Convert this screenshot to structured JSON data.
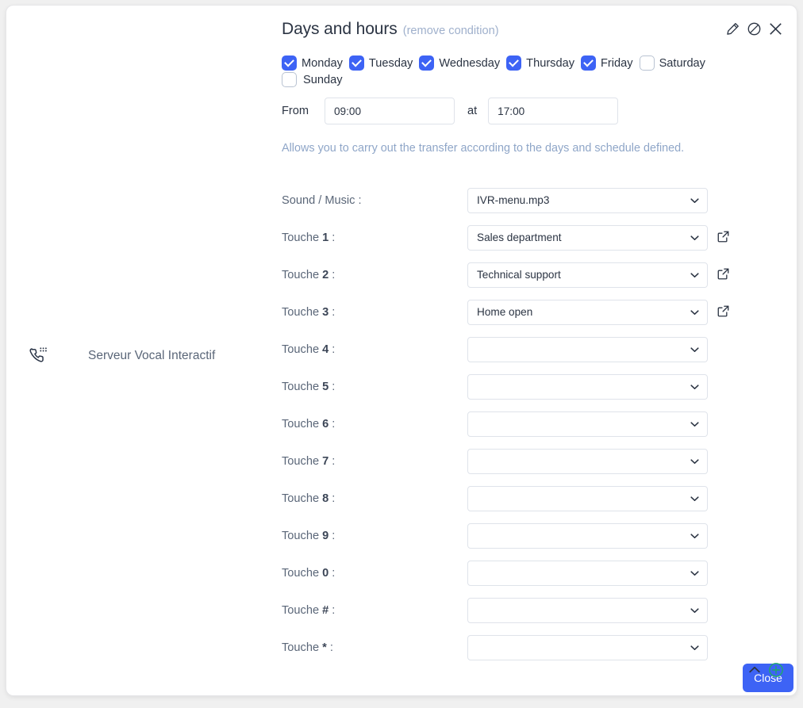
{
  "node": {
    "icon": "ivr-phone-keypad-icon",
    "label": "Serveur Vocal Interactif"
  },
  "panel": {
    "title": "Days and hours",
    "subtitle_open": "(",
    "subtitle_link": "remove condition",
    "subtitle_close": ")",
    "actions": [
      {
        "name": "edit-icon",
        "title": "Edit"
      },
      {
        "name": "disable-icon",
        "title": "Disable"
      },
      {
        "name": "close-icon",
        "title": "Close"
      }
    ],
    "days": [
      {
        "label": "Monday",
        "checked": true
      },
      {
        "label": "Tuesday",
        "checked": true
      },
      {
        "label": "Wednesday",
        "checked": true
      },
      {
        "label": "Thursday",
        "checked": true
      },
      {
        "label": "Friday",
        "checked": true
      },
      {
        "label": "Saturday",
        "checked": false
      },
      {
        "label": "Sunday",
        "checked": false
      }
    ],
    "time": {
      "from_label": "From",
      "from_value": "09:00",
      "at_label": "at",
      "at_value": "17:00"
    },
    "hint": "Allows you to carry out the transfer according to the days and schedule defined."
  },
  "form": {
    "rows": [
      {
        "label_prefix": "Sound / Music",
        "key": "",
        "label_suffix": " :",
        "value": "IVR-menu.mp3",
        "external": false
      },
      {
        "label_prefix": "Touche ",
        "key": "1",
        "label_suffix": " :",
        "value": "Sales department",
        "external": true
      },
      {
        "label_prefix": "Touche ",
        "key": "2",
        "label_suffix": " :",
        "value": "Technical support",
        "external": true
      },
      {
        "label_prefix": "Touche ",
        "key": "3",
        "label_suffix": " :",
        "value": "Home open",
        "external": true
      },
      {
        "label_prefix": "Touche ",
        "key": "4",
        "label_suffix": " :",
        "value": "",
        "external": false
      },
      {
        "label_prefix": "Touche ",
        "key": "5",
        "label_suffix": " :",
        "value": "",
        "external": false
      },
      {
        "label_prefix": "Touche ",
        "key": "6",
        "label_suffix": " :",
        "value": "",
        "external": false
      },
      {
        "label_prefix": "Touche ",
        "key": "7",
        "label_suffix": " :",
        "value": "",
        "external": false
      },
      {
        "label_prefix": "Touche ",
        "key": "8",
        "label_suffix": " :",
        "value": "",
        "external": false
      },
      {
        "label_prefix": "Touche ",
        "key": "9",
        "label_suffix": " :",
        "value": "",
        "external": false
      },
      {
        "label_prefix": "Touche ",
        "key": "0",
        "label_suffix": " :",
        "value": "",
        "external": false
      },
      {
        "label_prefix": "Touche ",
        "key": "#",
        "label_suffix": " :",
        "value": "",
        "external": false
      },
      {
        "label_prefix": "Touche ",
        "key": "*",
        "label_suffix": " :",
        "value": "",
        "external": false
      }
    ]
  },
  "footer": {
    "close_label": "Close",
    "collapse_icon": "chevron-up-icon",
    "add_icon": "add-circle-icon"
  },
  "colors": {
    "accent_blue": "#3d63f5",
    "link_blue": "#9fb0cc",
    "hint_blue": "#8fa6c8",
    "add_green": "#1faa6a",
    "text_dark": "#2b3443",
    "label_gray": "#5a6678"
  }
}
